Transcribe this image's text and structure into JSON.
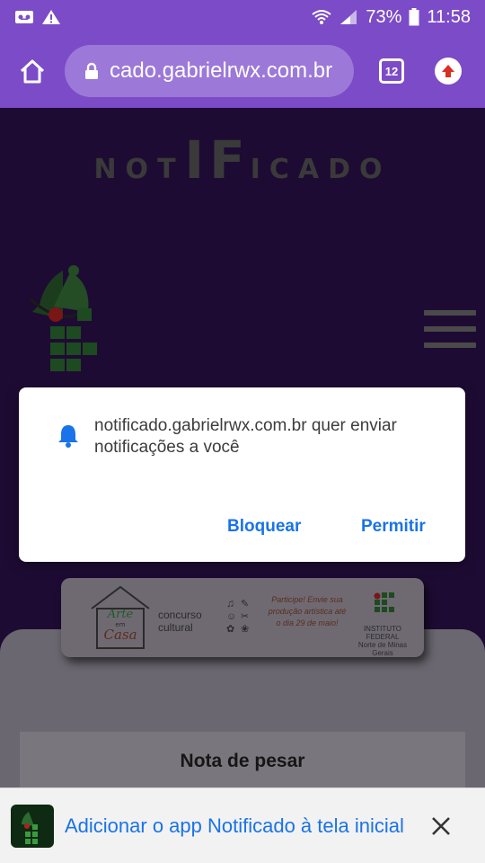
{
  "status_bar": {
    "battery": "73%",
    "time": "11:58",
    "icons": [
      "voicemail-icon",
      "warning-icon",
      "wifi-icon",
      "signal-icon",
      "battery-icon"
    ]
  },
  "browser": {
    "url": "cado.gabrielrwx.com.br",
    "tab_count": "12"
  },
  "site": {
    "title_parts": [
      "NOT",
      "IF",
      "ICADO"
    ]
  },
  "banner": {
    "arte": "Arte",
    "em": "em",
    "casa": "Casa",
    "label_line1": "concurso",
    "label_line2": "cultural",
    "promo": "Participe! Envie sua produção artística até o dia 29 de maio!",
    "ifnm_line1": "INSTITUTO",
    "ifnm_line2": "FEDERAL",
    "ifnm_line3": "Norte de Minas Gerais"
  },
  "dialog": {
    "message": "notificado.gabrielrwx.com.br quer enviar notificações a você",
    "block_label": "Bloquear",
    "allow_label": "Permitir"
  },
  "card": {
    "title": "Nota de pesar"
  },
  "a2hs": {
    "text": "Adicionar o app Notificado à tela inicial"
  },
  "colors": {
    "chrome": "#7c4bc7",
    "page_bg": "#1e0b33",
    "link_blue": "#1a73e8"
  }
}
